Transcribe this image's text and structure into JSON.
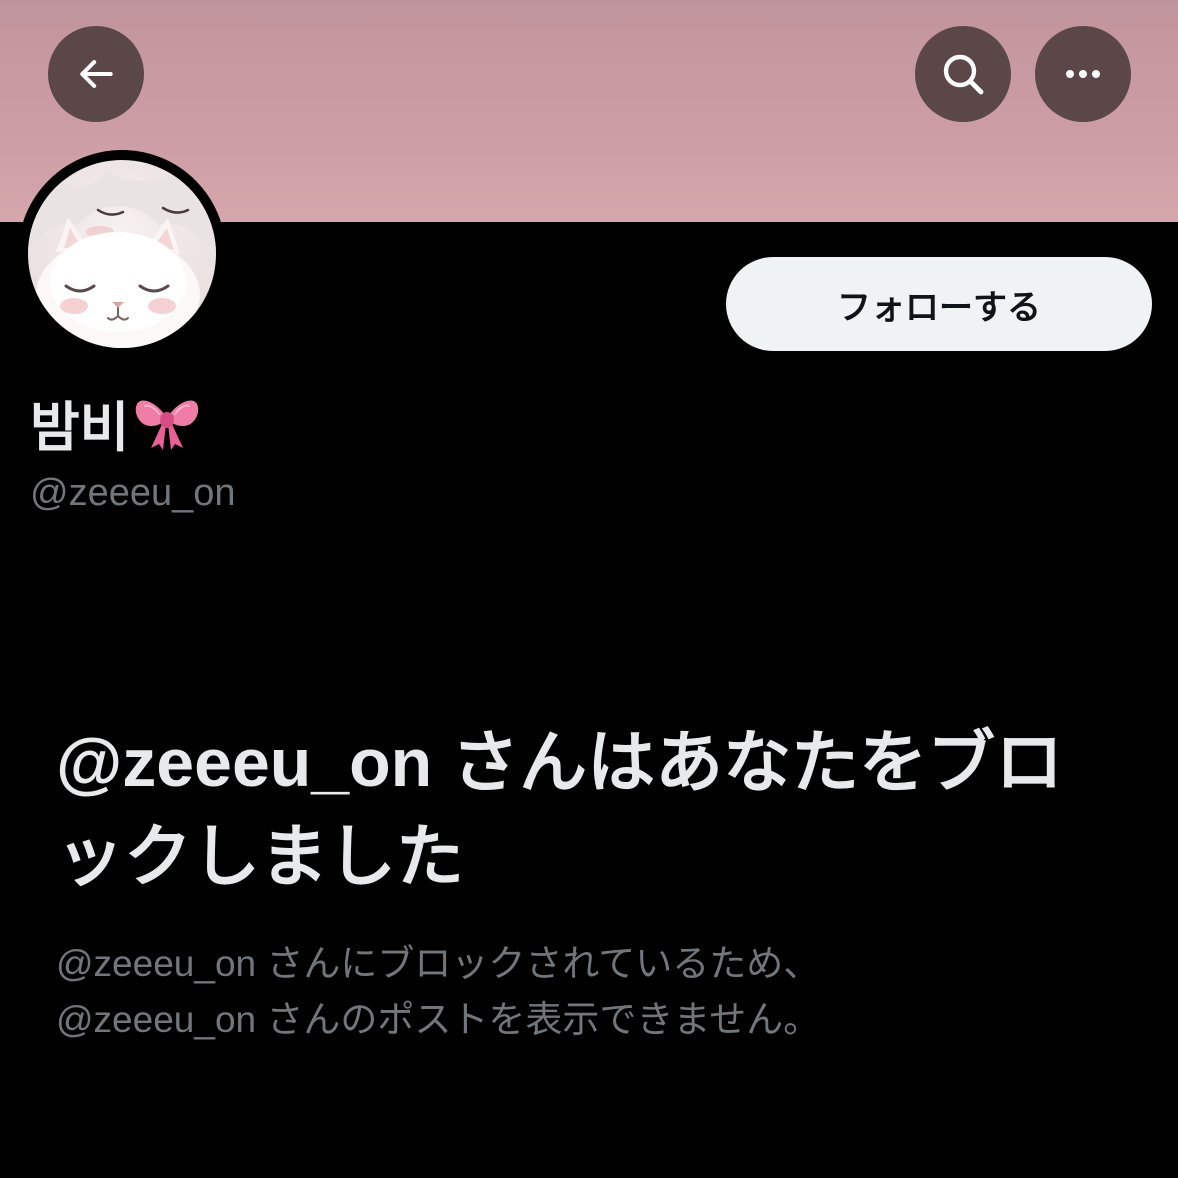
{
  "header": {
    "back_icon": "arrow-left-icon",
    "search_icon": "search-icon",
    "more_icon": "more-horizontal-icon",
    "banner_color": "#cc9ca4",
    "button_color": "#5b4648"
  },
  "profile": {
    "avatar_icon": "avatar-cat-icon",
    "display_name": "밤비",
    "name_emoji_icon": "pink-bow-icon",
    "handle": "@zeeeu_on",
    "follow_label": "フォローする"
  },
  "blocked": {
    "title": "@zeeeu_on さんはあなたをブロックしました",
    "description_line1": "@zeeeu_on さんにブロックされているため、",
    "description_line2": "@zeeeu_on さんのポストを表示できません。"
  },
  "colors": {
    "background": "#000000",
    "primary_text": "#e7e9ea",
    "secondary_text": "#71767b",
    "follow_button": "#eff3f4"
  }
}
